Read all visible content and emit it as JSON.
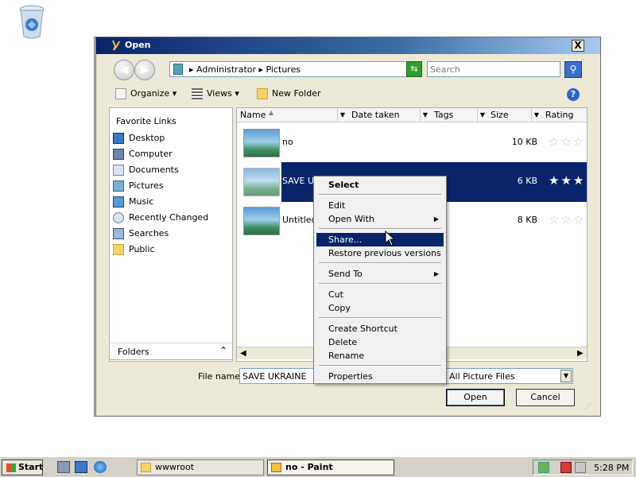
{
  "dialog": {
    "title": "Open",
    "close_glyph": "X",
    "address": {
      "path": "▸  Administrator  ▸  Pictures",
      "dropdown_glyph": "▼"
    },
    "search_placeholder": "Search",
    "toolbar": {
      "organize": "Organize ▾",
      "views": "Views ▾",
      "new_folder": "New Folder"
    },
    "nav": {
      "header": "Favorite Links",
      "items": [
        "Desktop",
        "Computer",
        "Documents",
        "Pictures",
        "Music",
        "Recently Changed",
        "Searches",
        "Public"
      ],
      "folders_label": "Folders"
    },
    "columns": [
      "Name",
      "Date taken",
      "Tags",
      "Size",
      "Rating"
    ],
    "files": [
      {
        "name": "no",
        "size": "10 KB",
        "rating": 0
      },
      {
        "name": "SAVE UKRAINE",
        "display": "SAVE UK",
        "size": "6 KB",
        "rating": 3
      },
      {
        "name": "Untitled",
        "size": "8 KB",
        "rating": 0
      }
    ],
    "file_name_label": "File name:",
    "file_name_value": "SAVE UKRAINE",
    "file_type_value": "All Picture Files",
    "open_label": "Open",
    "cancel_label": "Cancel"
  },
  "context_menu": {
    "items": [
      {
        "label": "Select",
        "bold": true
      },
      {
        "sep": true
      },
      {
        "label": "Edit"
      },
      {
        "label": "Open With",
        "submenu": true
      },
      {
        "sep": true
      },
      {
        "label": "Share...",
        "highlighted": true
      },
      {
        "label": "Restore previous versions"
      },
      {
        "sep": true
      },
      {
        "label": "Send To",
        "submenu": true
      },
      {
        "sep": true
      },
      {
        "label": "Cut"
      },
      {
        "label": "Copy"
      },
      {
        "sep": true
      },
      {
        "label": "Create Shortcut"
      },
      {
        "label": "Delete"
      },
      {
        "label": "Rename"
      },
      {
        "sep": true
      },
      {
        "label": "Properties"
      }
    ]
  },
  "taskbar": {
    "start_label": "Start",
    "tasks": [
      {
        "label": "wwwroot"
      },
      {
        "label": "no - Paint",
        "active": true
      }
    ],
    "clock": "5:28 PM"
  },
  "colors": {
    "titlebar": "#0a246a",
    "selection": "#0a246a",
    "menu_bg": "#f0f0f0"
  }
}
